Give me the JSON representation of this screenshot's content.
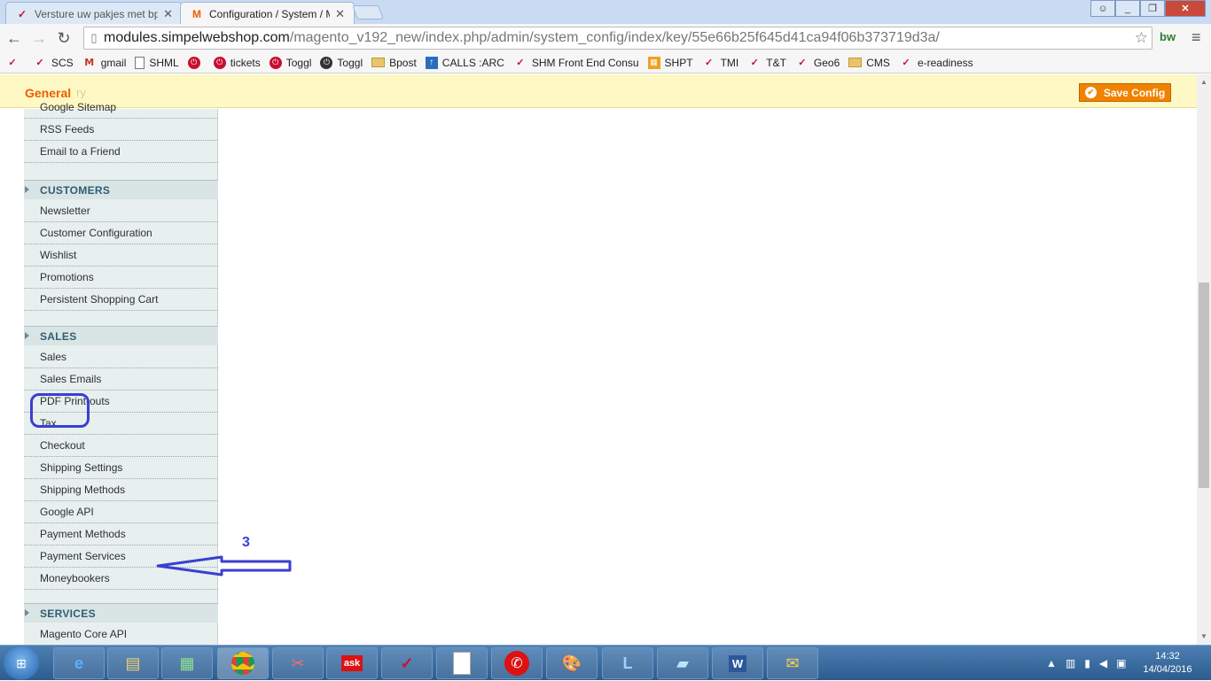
{
  "browser": {
    "tabs": [
      {
        "title": "Versture uw pakjes met bp",
        "active": false
      },
      {
        "title": "Configuration / System / M",
        "active": true
      }
    ],
    "window_buttons": {
      "minimize": "_",
      "maximize": "❐",
      "close": "✕"
    },
    "url_host": "modules.simpelwebshop.com",
    "url_path": "/magento_v192_new/index.php/admin/system_config/index/key/55e66b25f645d41ca94f06b373719d3a/",
    "extension_label": "bw",
    "bookmarks": [
      {
        "label": "",
        "icon": "redmark"
      },
      {
        "label": "SCS",
        "icon": "redmark"
      },
      {
        "label": "gmail",
        "icon": "gm"
      },
      {
        "label": "SHML",
        "icon": "doc"
      },
      {
        "label": "",
        "icon": "redcirc"
      },
      {
        "label": "tickets",
        "icon": "redcirc"
      },
      {
        "label": "Toggl",
        "icon": "redcirc"
      },
      {
        "label": "Toggl",
        "icon": "darkcirc"
      },
      {
        "label": "Bpost",
        "icon": "folder"
      },
      {
        "label": "CALLS :ARC",
        "icon": "bluebox"
      },
      {
        "label": "SHM Front End Consu",
        "icon": "redmark"
      },
      {
        "label": "SHPT",
        "icon": "orangebox"
      },
      {
        "label": "TMI",
        "icon": "redmark"
      },
      {
        "label": "T&T",
        "icon": "redmark"
      },
      {
        "label": "Geo6",
        "icon": "redmark"
      },
      {
        "label": "CMS",
        "icon": "folder"
      },
      {
        "label": "e-readiness",
        "icon": "redmark"
      }
    ]
  },
  "header": {
    "section_title": "General",
    "ghost_text": "ry",
    "save_button": "Save Config"
  },
  "sidebar": {
    "top_items": [
      "Google Sitemap",
      "RSS Feeds",
      "Email to a Friend"
    ],
    "customers": {
      "title": "CUSTOMERS",
      "items": [
        "Newsletter",
        "Customer Configuration",
        "Wishlist",
        "Promotions",
        "Persistent Shopping Cart"
      ]
    },
    "sales": {
      "title": "SALES",
      "items": [
        "Sales",
        "Sales Emails",
        "PDF Print-outs",
        "Tax",
        "Checkout",
        "Shipping Settings",
        "Shipping Methods",
        "Google API",
        "Payment Methods",
        "Payment Services",
        "Moneybookers"
      ]
    },
    "services": {
      "title": "SERVICES",
      "items": [
        "Magento Core API"
      ]
    }
  },
  "annotation": {
    "step_number": "3"
  },
  "taskbar": {
    "clock_time": "14:32",
    "clock_date": "14/04/2016"
  }
}
